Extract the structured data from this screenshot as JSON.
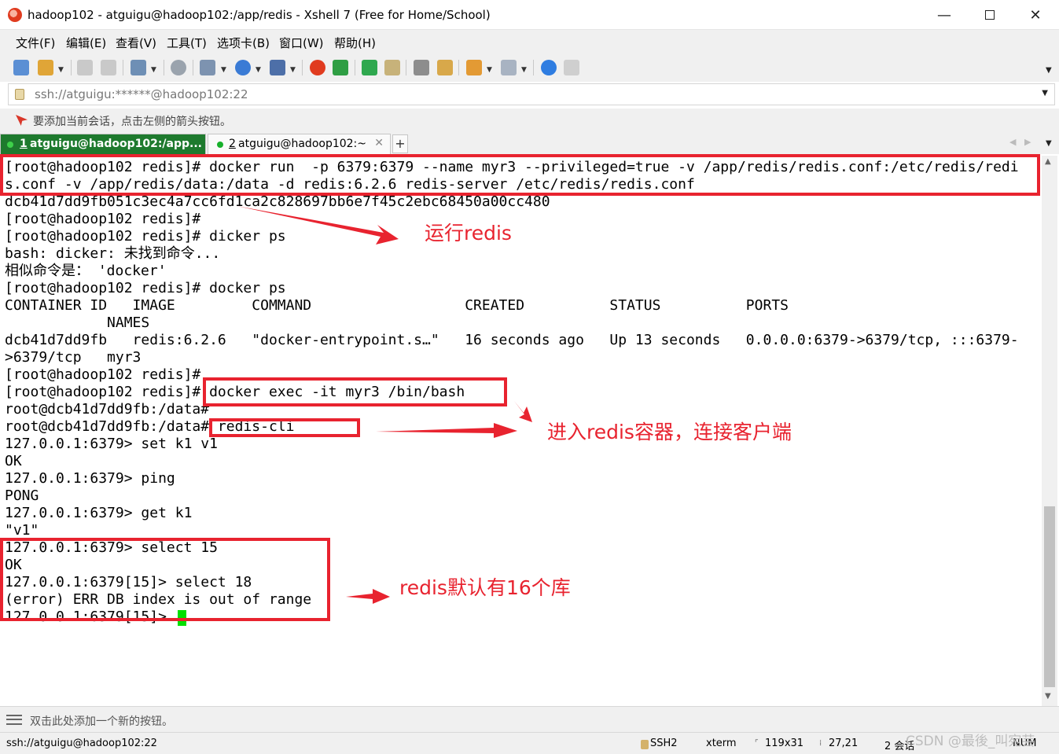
{
  "window": {
    "title": "hadoop102 - atguigu@hadoop102:/app/redis - Xshell 7 (Free for Home/School)",
    "minimize": "—",
    "close": "✕"
  },
  "menu": [
    "文件(F)",
    "编辑(E)",
    "查看(V)",
    "工具(T)",
    "选项卡(B)",
    "窗口(W)",
    "帮助(H)"
  ],
  "address": {
    "value": "ssh://atguigu:******@hadoop102:22"
  },
  "hint": "要添加当前会话，点击左侧的箭头按钮。",
  "tabs": [
    {
      "number": "1",
      "label": "atguigu@hadoop102:/app...",
      "active": true,
      "close": ""
    },
    {
      "number": "2",
      "label": "atguigu@hadoop102:~",
      "active": false,
      "close": "✕"
    }
  ],
  "tab_add": "+",
  "terminal": {
    "lines": [
      "[root@hadoop102 redis]# docker run  -p 6379:6379 --name myr3 --privileged=true -v /app/redis/redis.conf:/etc/redis/redi",
      "s.conf -v /app/redis/data:/data -d redis:6.2.6 redis-server /etc/redis/redis.conf",
      "dcb41d7dd9fb051c3ec4a7cc6fd1ca2c828697bb6e7f45c2ebc68450a00cc480",
      "[root@hadoop102 redis]#",
      "[root@hadoop102 redis]# dicker ps",
      "bash: dicker: 未找到命令...",
      "相似命令是： 'docker'",
      "[root@hadoop102 redis]# docker ps",
      "CONTAINER ID   IMAGE         COMMAND                  CREATED          STATUS          PORTS",
      "            NAMES",
      "dcb41d7dd9fb   redis:6.2.6   \"docker-entrypoint.s…\"   16 seconds ago   Up 13 seconds   0.0.0.0:6379->6379/tcp, :::6379-",
      ">6379/tcp   myr3",
      "[root@hadoop102 redis]#",
      "[root@hadoop102 redis]# docker exec -it myr3 /bin/bash",
      "root@dcb41d7dd9fb:/data#",
      "root@dcb41d7dd9fb:/data# redis-cli",
      "127.0.0.1:6379> set k1 v1",
      "OK",
      "127.0.0.1:6379> ping",
      "PONG",
      "127.0.0.1:6379> get k1",
      "\"v1\"",
      "127.0.0.1:6379> select 15",
      "OK",
      "127.0.0.1:6379[15]> select 18",
      "(error) ERR DB index is out of range",
      "127.0.0.1:6379[15]> "
    ]
  },
  "annotations": {
    "run_redis": "运行redis",
    "enter_container": "进入redis容器，连接客户端",
    "db_count": "redis默认有16个库"
  },
  "quickbar": "双击此处添加一个新的按钮。",
  "status": {
    "connection": "ssh://atguigu@hadoop102:22",
    "protocol": "SSH2",
    "terminal": "xterm",
    "size": "119x31",
    "cursor": "27,21",
    "sessions": "2 会话",
    "num": "NUM"
  },
  "watermark": "CSDN @最後_叫宛芸"
}
